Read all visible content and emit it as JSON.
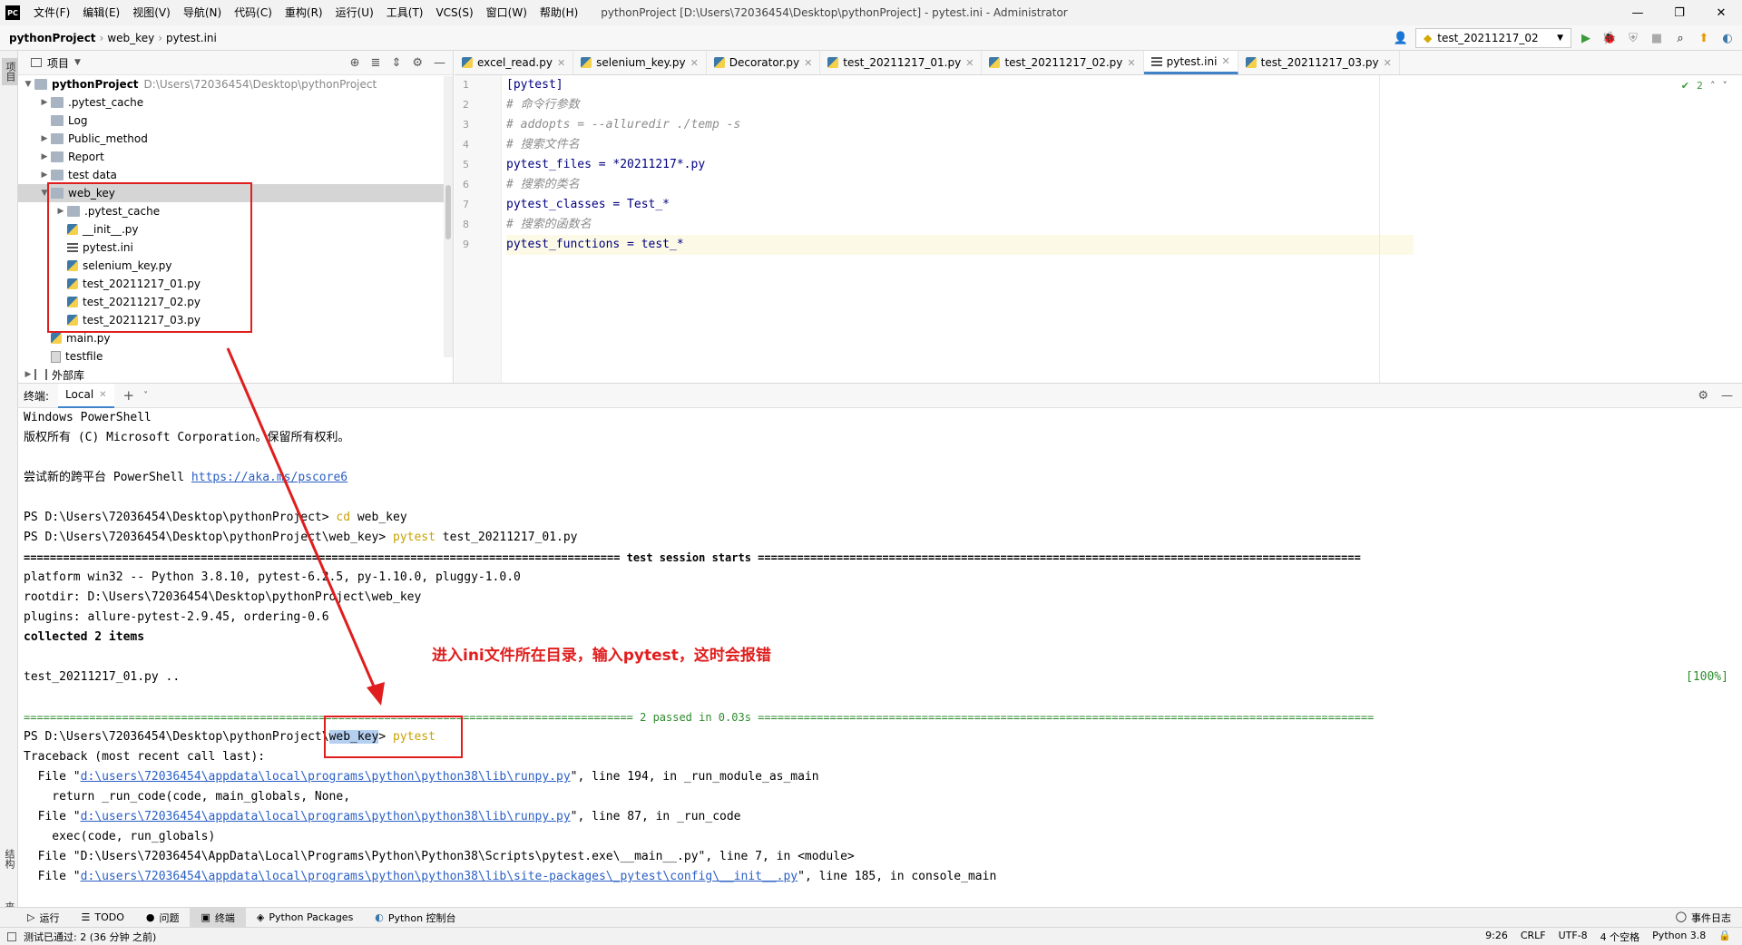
{
  "menubar": {
    "logo": "PC",
    "items": [
      "文件(F)",
      "编辑(E)",
      "视图(V)",
      "导航(N)",
      "代码(C)",
      "重构(R)",
      "运行(U)",
      "工具(T)",
      "VCS(S)",
      "窗口(W)",
      "帮助(H)"
    ],
    "window_title": "pythonProject [D:\\Users\\72036454\\Desktop\\pythonProject] - pytest.ini - Administrator"
  },
  "navbar": {
    "crumbs": [
      "pythonProject",
      "web_key",
      "pytest.ini"
    ],
    "run_config": "test_20211217_02"
  },
  "leftstrip": {
    "project_label": "项目",
    "structure_label": "结构",
    "favorites_label": "收藏夹"
  },
  "project": {
    "title": "项目",
    "tree": [
      {
        "label": "pythonProject",
        "path": "D:\\Users\\72036454\\Desktop\\pythonProject"
      },
      {
        "label": ".pytest_cache"
      },
      {
        "label": "Log"
      },
      {
        "label": "Public_method"
      },
      {
        "label": "Report"
      },
      {
        "label": "test data"
      },
      {
        "label": "web_key"
      },
      {
        "label": ".pytest_cache"
      },
      {
        "label": "__init__.py"
      },
      {
        "label": "pytest.ini"
      },
      {
        "label": "selenium_key.py"
      },
      {
        "label": "test_20211217_01.py"
      },
      {
        "label": "test_20211217_02.py"
      },
      {
        "label": "test_20211217_03.py"
      },
      {
        "label": "main.py"
      },
      {
        "label": "testfile"
      },
      {
        "label": "外部库"
      }
    ]
  },
  "editor": {
    "tabs": [
      "excel_read.py",
      "selenium_key.py",
      "Decorator.py",
      "test_20211217_01.py",
      "test_20211217_02.py",
      "pytest.ini",
      "test_20211217_03.py"
    ],
    "active_tab": "pytest.ini",
    "inspection_count": "2",
    "lines": [
      {
        "num": "1",
        "text": "[pytest]"
      },
      {
        "num": "2",
        "text": "# 命令行参数"
      },
      {
        "num": "3",
        "text": "# addopts = --alluredir ./temp -s"
      },
      {
        "num": "4",
        "text": "# 搜索文件名"
      },
      {
        "num": "5",
        "text": "pytest_files = *20211217*.py"
      },
      {
        "num": "6",
        "text": "# 搜索的类名"
      },
      {
        "num": "7",
        "text": "pytest_classes = Test_*"
      },
      {
        "num": "8",
        "text": "# 搜索的函数名"
      },
      {
        "num": "9",
        "text": "pytest_functions = test_*"
      }
    ]
  },
  "terminal": {
    "title": "终端:",
    "tab": "Local",
    "lines": {
      "l1": "Windows PowerShell",
      "l2": "版权所有 (C) Microsoft Corporation。保留所有权利。",
      "l4a": "尝试新的跨平台 PowerShell ",
      "l4b": "https://aka.ms/pscore6",
      "l6a": "PS D:\\Users\\72036454\\Desktop\\pythonProject> ",
      "l6b": "cd",
      "l6c": " web_key",
      "l7a": "PS D:\\Users\\72036454\\Desktop\\pythonProject\\web_key> ",
      "l7b": "pytest",
      "l7c": " test_20211217_01.py",
      "l8": "=========================================================================================== test session starts ============================================================================================",
      "l9": "platform win32 -- Python 3.8.10, pytest-6.2.5, py-1.10.0, pluggy-1.0.0",
      "l10": "rootdir: D:\\Users\\72036454\\Desktop\\pythonProject\\web_key",
      "l11": "plugins: allure-pytest-2.9.45, ordering-0.6",
      "l12": "collected 2 items",
      "l14a": "test_20211217_01.py ..",
      "l14b": "[100%]",
      "l16": "============================================================================================= 2 passed in 0.03s ==============================================================================================",
      "l17a": "PS D:\\Users\\72036454\\Desktop\\pythonProject\\",
      "l17b": "web_key",
      "l17c": "> ",
      "l17d": "pytest",
      "l18": "Traceback (most recent call last):",
      "l19a": "  File \"",
      "l19b": "d:\\users\\72036454\\appdata\\local\\programs\\python\\python38\\lib\\runpy.py",
      "l19c": "\", line 194, in _run_module_as_main",
      "l20": "    return _run_code(code, main_globals, None,",
      "l21a": "  File \"",
      "l21b": "d:\\users\\72036454\\appdata\\local\\programs\\python\\python38\\lib\\runpy.py",
      "l21c": "\", line 87, in _run_code",
      "l22": "    exec(code, run_globals)",
      "l23": "  File \"D:\\Users\\72036454\\AppData\\Local\\Programs\\Python\\Python38\\Scripts\\pytest.exe\\__main__.py\", line 7, in <module>",
      "l24a": "  File \"",
      "l24b": "d:\\users\\72036454\\appdata\\local\\programs\\python\\python38\\lib\\site-packages\\_pytest\\config\\__init__.py",
      "l24c": "\", line 185, in console_main"
    }
  },
  "annotation": "进入ini文件所在目录，输入pytest，这时会报错",
  "bottom_tabs": [
    "运行",
    "TODO",
    "问题",
    "终端",
    "Python Packages",
    "Python 控制台"
  ],
  "event_log": "事件日志",
  "status": {
    "message": "测试已通过: 2 (36 分钟 之前)",
    "position": "9:26",
    "line_sep": "CRLF",
    "encoding": "UTF-8",
    "indent": "4 个空格",
    "interpreter": "Python 3.8"
  },
  "colors": {
    "accent": "#4083c9",
    "annotation_red": "#e01e1e",
    "link": "#2a5fc4",
    "pass_green": "#2e8b2e"
  }
}
